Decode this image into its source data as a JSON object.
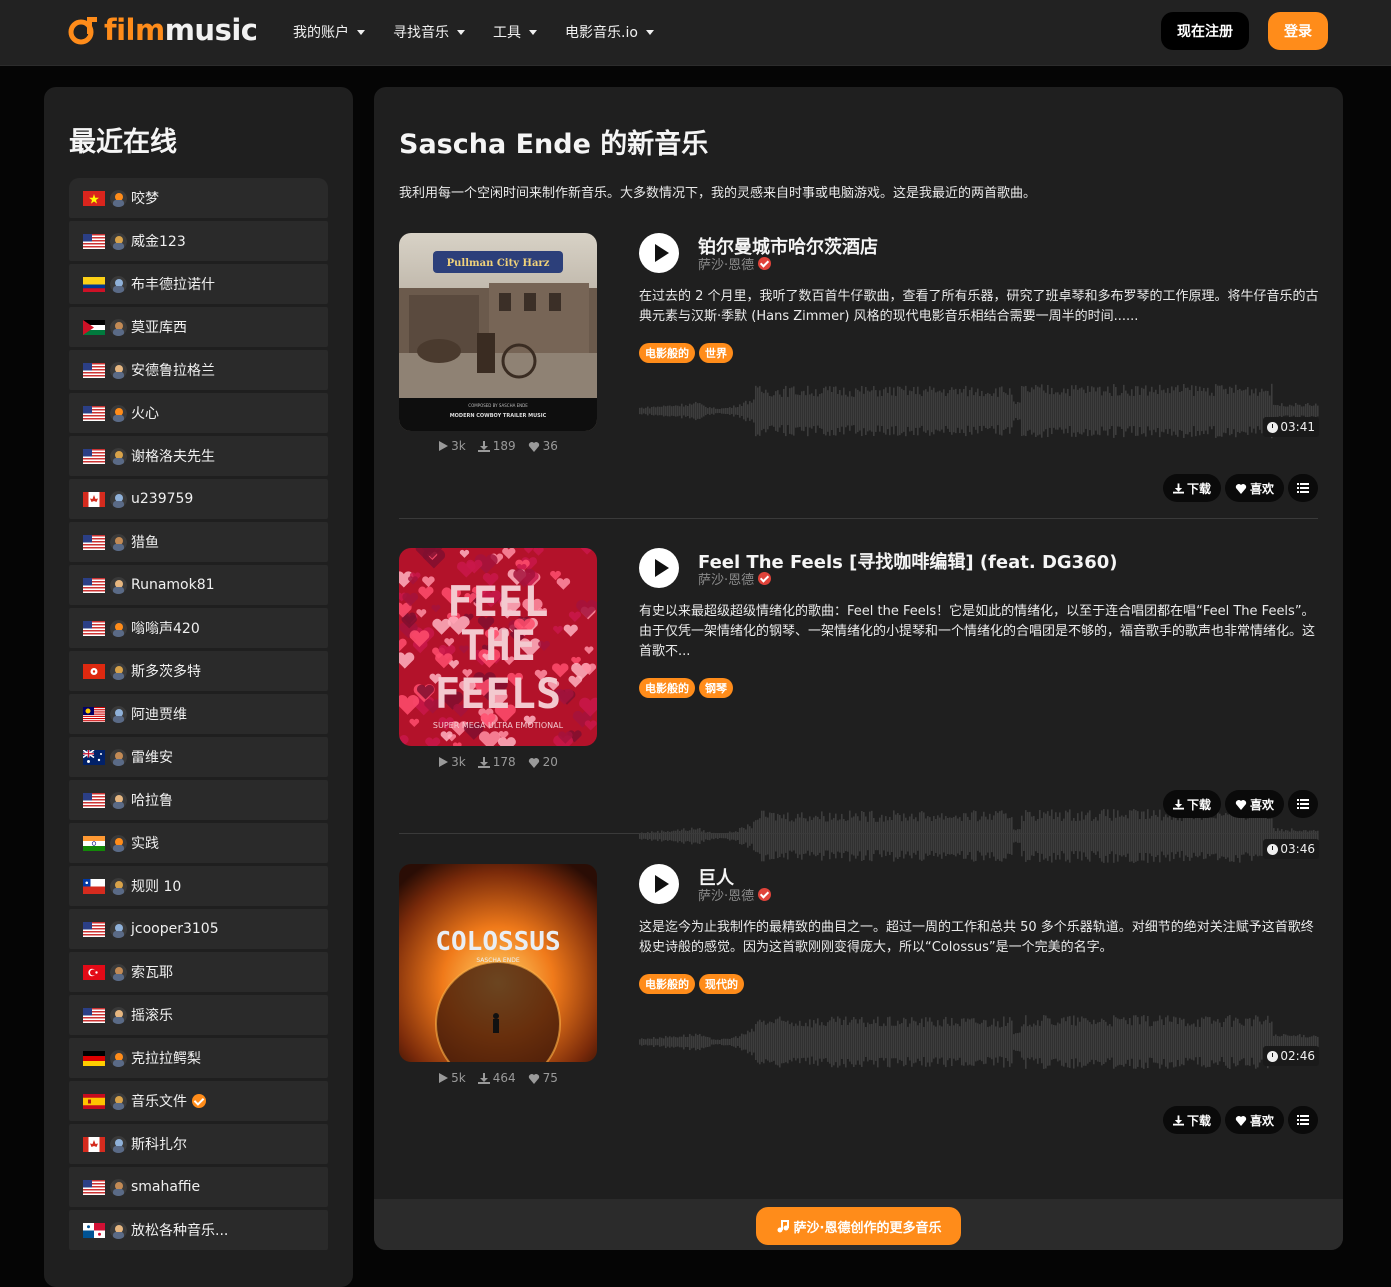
{
  "brand": {
    "logo_film": "film",
    "logo_music": "music",
    "accent": "#ff8c1a"
  },
  "nav": {
    "items": [
      {
        "label": "我的账户"
      },
      {
        "label": "寻找音乐"
      },
      {
        "label": "工具"
      },
      {
        "label": "电影音乐.io"
      }
    ],
    "register_label": "现在注册",
    "login_label": "登录"
  },
  "sidebar": {
    "title": "最近在线",
    "users": [
      {
        "name": "咬梦",
        "flag": "vn",
        "verified": false
      },
      {
        "name": "威金123",
        "flag": "us",
        "verified": false
      },
      {
        "name": "布丰德拉诺什",
        "flag": "co",
        "verified": false
      },
      {
        "name": "莫亚库西",
        "flag": "jo",
        "verified": false
      },
      {
        "name": "安德鲁拉格兰",
        "flag": "us",
        "verified": false
      },
      {
        "name": "火心",
        "flag": "us",
        "verified": false
      },
      {
        "name": "谢格洛夫先生",
        "flag": "us",
        "verified": false
      },
      {
        "name": "u239759",
        "flag": "ca",
        "verified": false
      },
      {
        "name": "猎鱼",
        "flag": "us",
        "verified": false
      },
      {
        "name": "Runamok81",
        "flag": "us",
        "verified": false
      },
      {
        "name": "嗡嗡声420",
        "flag": "us",
        "verified": false
      },
      {
        "name": "斯多茨多特",
        "flag": "hk",
        "verified": false
      },
      {
        "name": "阿迪贾维",
        "flag": "my",
        "verified": false
      },
      {
        "name": "雷维安",
        "flag": "au",
        "verified": false
      },
      {
        "name": "哈拉鲁",
        "flag": "us",
        "verified": false
      },
      {
        "name": "实践",
        "flag": "in",
        "verified": false
      },
      {
        "name": "规则 10",
        "flag": "cl",
        "verified": false
      },
      {
        "name": "jcooper3105",
        "flag": "us",
        "verified": false
      },
      {
        "name": "索瓦耶",
        "flag": "tr",
        "verified": false
      },
      {
        "name": "摇滚乐",
        "flag": "us",
        "verified": false
      },
      {
        "name": "克拉拉鳄梨",
        "flag": "de",
        "verified": false
      },
      {
        "name": "音乐文件",
        "flag": "es",
        "verified": true
      },
      {
        "name": "斯科扎尔",
        "flag": "ca",
        "verified": false
      },
      {
        "name": "smahaffie",
        "flag": "us",
        "verified": false
      },
      {
        "name": "放松各种音乐...",
        "flag": "pa",
        "verified": false
      }
    ]
  },
  "main": {
    "title": "Sascha Ende 的新音乐",
    "description": "我利用每一个空闲时间来制作新音乐。大多数情况下，我的灵感来自时事或电脑游戏。这是我最近的两首歌曲。",
    "tracks": [
      {
        "title": "铂尔曼城市哈尔茨酒店",
        "artist": "萨沙·恩德",
        "description": "在过去的 2 个月里，我听了数百首牛仔歌曲，查看了所有乐器，研究了班卓琴和多布罗琴的工作原理。将牛仔音乐的古典元素与汉斯·季默 (Hans Zimmer) 风格的现代电影音乐相结合需要一周半的时间......",
        "tags": [
          "电影般的",
          "世界"
        ],
        "duration": "03:41",
        "plays": "3k",
        "downloads": "189",
        "likes": "36",
        "cover": "western"
      },
      {
        "title": "Feel The Feels [寻找咖啡编辑] (feat. DG360)",
        "artist": "萨沙·恩德",
        "description": "有史以来最超级超级情绪化的歌曲：Feel the Feels！它是如此的情绪化，以至于连合唱团都在唱“Feel The Feels”。由于仅凭一架情绪化的钢琴、一架情绪化的小提琴和一个情绪化的合唱团是不够的，福音歌手的歌声也非常情绪化。这首歌不...",
        "tags": [
          "电影般的",
          "钢琴"
        ],
        "duration": "03:46",
        "plays": "3k",
        "downloads": "178",
        "likes": "20",
        "cover": "feels"
      },
      {
        "title": "巨人",
        "artist": "萨沙·恩德",
        "description": "这是迄今为止我制作的最精致的曲目之一。超过一周的工作和总共 50 多个乐器轨道。对细节的绝对关注赋予这首歌终极史诗般的感觉。因为这首歌刚刚变得庞大，所以“Colossus”是一个完美的名字。",
        "tags": [
          "电影般的",
          "现代的"
        ],
        "duration": "02:46",
        "plays": "5k",
        "downloads": "464",
        "likes": "75",
        "cover": "colossus"
      }
    ],
    "action_labels": {
      "download": "下载",
      "like": "喜欢"
    },
    "covers": {
      "western": {
        "banner": "Pullman City Harz",
        "caption1": "COMPOSED BY SASCHA ENDE",
        "caption2": "MODERN COWBOY TRAILER MUSIC"
      },
      "feels": {
        "line1": "FEEL",
        "line2": "THE",
        "line3": "FEELS",
        "caption": "SUPER MEGA ULTRA EMOTIONAL"
      },
      "colossus": {
        "title": "COLOSSUS",
        "caption": "SASCHA ENDE"
      }
    },
    "more_label": "萨沙·恩德创作的更多音乐"
  }
}
